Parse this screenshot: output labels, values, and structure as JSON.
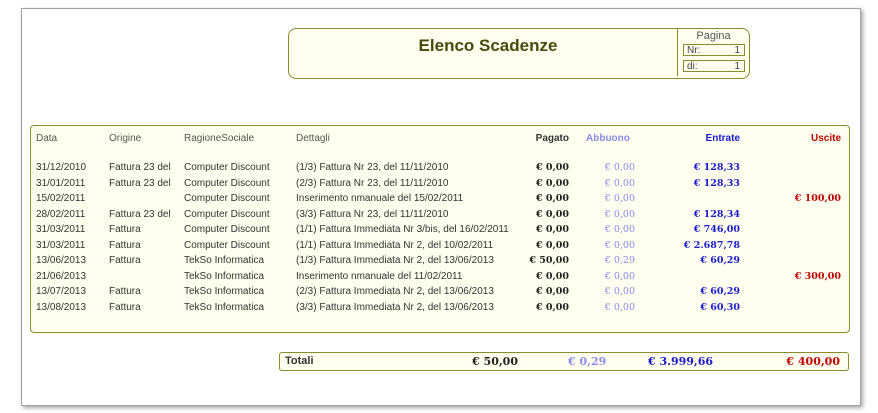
{
  "header": {
    "title": "Elenco Scadenze"
  },
  "page": {
    "label": "Pagina",
    "nr_label": "Nr:",
    "nr_value": "1",
    "di_label": "di:",
    "di_value": "1"
  },
  "columns": {
    "data": "Data",
    "origine": "Origine",
    "ragione": "RagioneSociale",
    "dettagli": "Dettagli",
    "pagato": "Pagato",
    "abbuono": "Abbuono",
    "entrate": "Entrate",
    "uscite": "Uscite"
  },
  "rows": [
    {
      "data": "31/12/2010",
      "origine": "Fattura 23 del",
      "ragione": "Computer Discount",
      "dettagli": "(1/3) Fattura Nr 23, del 11/11/2010",
      "pagato": "€ 0,00",
      "abbuono": "€ 0,00",
      "entrate": "€ 128,33",
      "uscite": ""
    },
    {
      "data": "31/01/2011",
      "origine": "Fattura 23 del",
      "ragione": "Computer Discount",
      "dettagli": "(2/3) Fattura Nr 23, del 11/11/2010",
      "pagato": "€ 0,00",
      "abbuono": "€ 0,00",
      "entrate": "€ 128,33",
      "uscite": ""
    },
    {
      "data": "15/02/2011",
      "origine": "",
      "ragione": "Computer Discount",
      "dettagli": "Inserimento nmanuale del 15/02/2011",
      "pagato": "€ 0,00",
      "abbuono": "€ 0,00",
      "entrate": "",
      "uscite": "€ 100,00"
    },
    {
      "data": "28/02/2011",
      "origine": "Fattura 23 del",
      "ragione": "Computer Discount",
      "dettagli": "(3/3) Fattura Nr 23, del 11/11/2010",
      "pagato": "€ 0,00",
      "abbuono": "€ 0,00",
      "entrate": "€ 128,34",
      "uscite": ""
    },
    {
      "data": "31/03/2011",
      "origine": "Fattura",
      "ragione": "Computer Discount",
      "dettagli": "(1/1) Fattura Immediata Nr 3/bis, del 16/02/2011",
      "pagato": "€ 0,00",
      "abbuono": "€ 0,00",
      "entrate": "€ 746,00",
      "uscite": ""
    },
    {
      "data": "31/03/2011",
      "origine": "Fattura",
      "ragione": "Computer Discount",
      "dettagli": "(1/1) Fattura Immediata Nr 2, del 10/02/2011",
      "pagato": "€ 0,00",
      "abbuono": "€ 0,00",
      "entrate": "€ 2.687,78",
      "uscite": ""
    },
    {
      "data": "13/06/2013",
      "origine": "Fattura",
      "ragione": "TekSo Informatica",
      "dettagli": "(1/3) Fattura Immediata Nr 2, del 13/06/2013",
      "pagato": "€ 50,00",
      "abbuono": "€ 0,29",
      "entrate": "€ 60,29",
      "uscite": ""
    },
    {
      "data": "21/06/2013",
      "origine": "",
      "ragione": "TekSo Informatica",
      "dettagli": "Inserimento nmanuale del 11/02/2011",
      "pagato": "€ 0,00",
      "abbuono": "€ 0,00",
      "entrate": "",
      "uscite": "€ 300,00"
    },
    {
      "data": "13/07/2013",
      "origine": "Fattura",
      "ragione": "TekSo Informatica",
      "dettagli": "(2/3) Fattura Immediata Nr 2, del 13/06/2013",
      "pagato": "€ 0,00",
      "abbuono": "€ 0,00",
      "entrate": "€ 60,29",
      "uscite": ""
    },
    {
      "data": "13/08/2013",
      "origine": "Fattura",
      "ragione": "TekSo Informatica",
      "dettagli": "(3/3) Fattura Immediata Nr 2, del 13/06/2013",
      "pagato": "€ 0,00",
      "abbuono": "€ 0,00",
      "entrate": "€ 60,30",
      "uscite": ""
    }
  ],
  "totals": {
    "label": "Totali",
    "pagato": "€ 50,00",
    "abbuono": "€ 0,29",
    "entrate": "€ 3.999,66",
    "uscite": "€ 400,00"
  },
  "colors": {
    "border": "#8c8a2a",
    "panel": "#fffff0",
    "entrate": "#1a1ad0",
    "abbuono": "#8b8bf0",
    "uscite": "#c00000"
  }
}
